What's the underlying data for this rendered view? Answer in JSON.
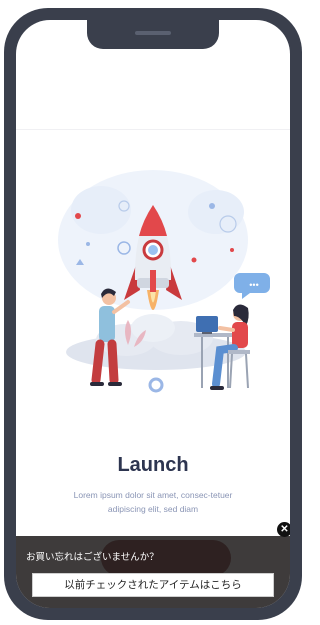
{
  "onboarding": {
    "title": "Launch",
    "description": "Lorem ipsum dolor sit amet, consec-tetuer adipiscing elit, sed diam"
  },
  "banner": {
    "message": "お買い忘れはございませんか？",
    "button_label": "以前チェックされたアイテムはこちら",
    "close_symbol": "✕"
  },
  "colors": {
    "phone_frame": "#3a3f4c",
    "title": "#2d3550",
    "description": "#8a95b5",
    "rocket_red": "#e2484b",
    "banner_bg": "#232020"
  },
  "illustration": {
    "name": "rocket-launch-illustration",
    "chat_bubble": "•••"
  }
}
